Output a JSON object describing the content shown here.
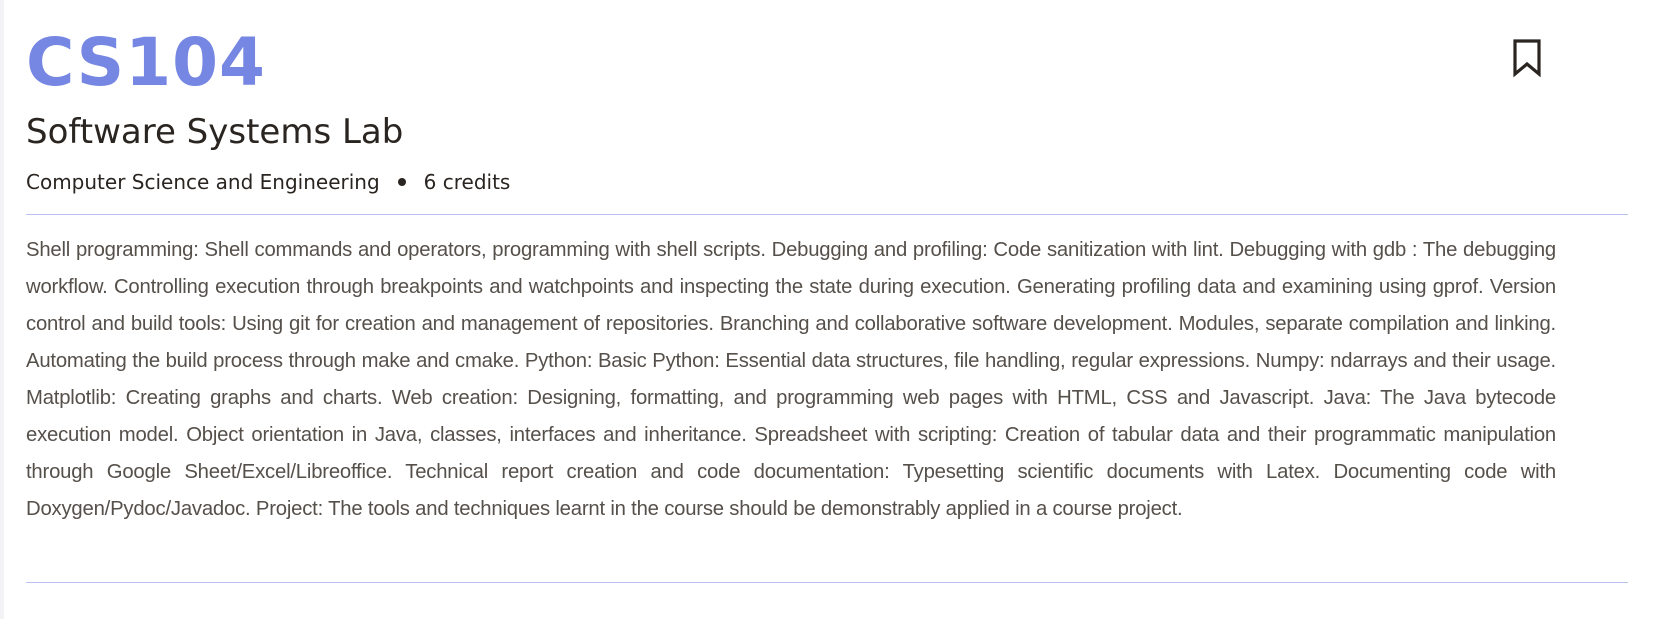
{
  "course": {
    "code": "CS104",
    "title": "Software Systems Lab",
    "department": "Computer Science and Engineering",
    "credits": "6 credits",
    "description": "Shell programming: Shell commands and operators, programming with shell scripts. Debugging and profiling: Code sanitization with lint. Debugging with gdb : The debugging workflow. Controlling execution through breakpoints and watchpoints and inspecting the state during execution. Generating profiling data and examining using gprof. Version control and build tools: Using git for creation and management of repositories. Branching and collaborative software development. Modules, separate compilation and linking. Automating the build process through make and cmake. Python: Basic Python: Essential data structures, file handling, regular expressions. Numpy: ndarrays and their usage. Matplotlib: Creating graphs and charts. Web creation: Designing, formatting, and programming web pages with HTML, CSS and Javascript. Java: The Java bytecode execution model. Object orientation in Java, classes, interfaces and inheritance. Spreadsheet with scripting: Creation of tabular data and their programmatic manipulation through Google Sheet/Excel/Libreoffice. Technical report creation and code documentation: Typesetting scientific documents with Latex. Documenting code with Doxygen/Pydoc/Javadoc. Project: The tools and techniques learnt in the course should be demonstrably applied in a course project."
  },
  "icons": {
    "bookmark": "bookmark-icon"
  },
  "colors": {
    "accent": "#7686e3",
    "text": "#2a2520",
    "description": "#56504b",
    "divider": "#b9c1ec"
  }
}
